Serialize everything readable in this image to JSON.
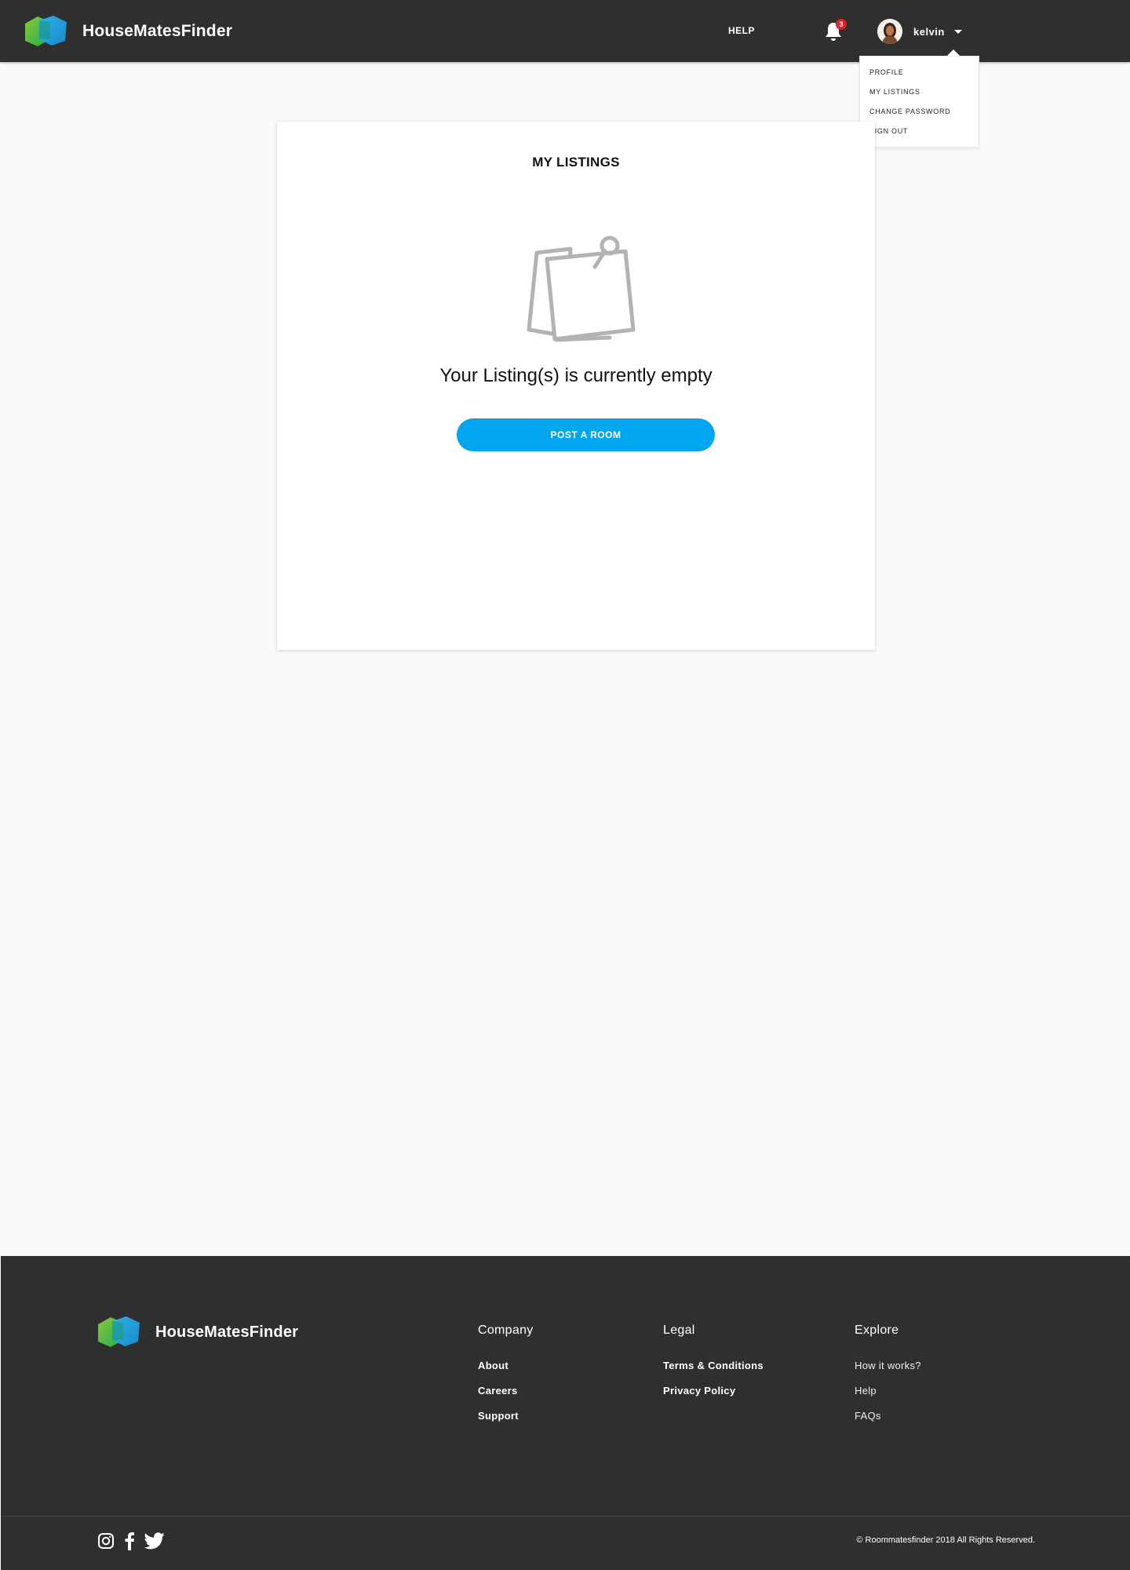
{
  "header": {
    "brand": "HouseMatesFinder",
    "help_label": "HELP",
    "notification_count": "3",
    "user_name": "kelvin"
  },
  "user_menu": {
    "items": [
      "PROFILE",
      "MY LISTINGS",
      "CHANGE PASSWORD",
      "SIGN OUT"
    ]
  },
  "main": {
    "title": "MY LISTINGS",
    "empty_message": "Your Listing(s) is currently empty",
    "cta_label": "POST A ROOM"
  },
  "footer": {
    "brand": "HouseMatesFinder",
    "columns": [
      {
        "heading": "Company",
        "links": [
          "About",
          "Careers",
          "Support"
        ]
      },
      {
        "heading": "Legal",
        "links": [
          "Terms & Conditions",
          "Privacy Policy"
        ]
      },
      {
        "heading": "Explore",
        "links": [
          "How it works?",
          "Help",
          "FAQs"
        ]
      }
    ],
    "social": [
      "instagram-icon",
      "facebook-icon",
      "twitter-icon"
    ],
    "copyright": "© Roommatesfinder 2018 All Rights Reserved."
  },
  "colors": {
    "header_bg": "#2f2f2f",
    "accent": "#02a6ef",
    "badge": "#e0202a",
    "page_bg": "#fafafa"
  }
}
